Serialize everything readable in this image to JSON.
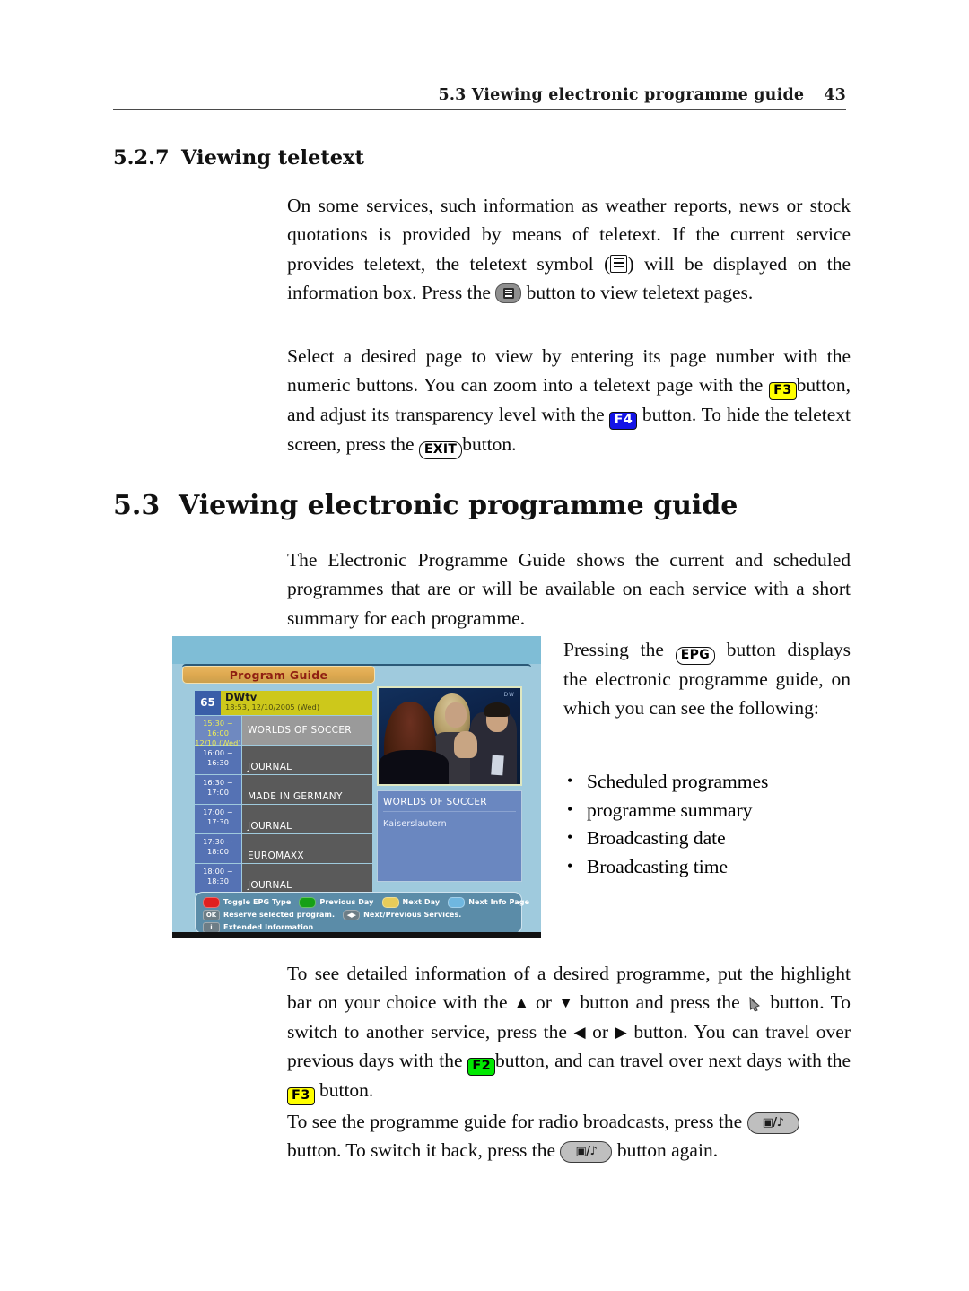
{
  "header": {
    "running_title": "5.3 Viewing electronic programme guide",
    "page_number": "43"
  },
  "sections": {
    "teletext": {
      "number": "5.2.7",
      "title": "Viewing teletext",
      "p1_a": "On some services, such information as weather reports, news or stock quotations is provided by means of teletext. If the current service provides teletext, the teletext symbol (",
      "p1_b": ") will be displayed on the information box. Press the",
      "p1_c": "button to view teletext pages.",
      "p2_a": "Select a desired page to view by entering its page number with the numeric buttons. You can zoom into a teletext page with the",
      "key_f3": "F3",
      "p2_b": "button, and adjust its transparency level with the",
      "key_f4": "F4",
      "p2_c": "button. To hide the teletext screen, press the",
      "key_exit": "EXIT",
      "p2_d": "button."
    },
    "epg": {
      "number": "5.3",
      "title": "Viewing electronic programme guide",
      "p1": "The Electronic Programme Guide shows the current and scheduled programmes that are or will be available on each service with a short summary for each programme.",
      "p2_a": "Pressing the",
      "key_epg": "EPG",
      "p2_b": "button displays the electronic programme guide, on which you can see the following:",
      "bullets": [
        "Scheduled programmes",
        "programme summary",
        "Broadcasting date",
        "Broadcasting time"
      ],
      "p3_a": "To see detailed information of a desired programme, put the highlight bar on your choice with the",
      "arrow_up": "▲",
      "p3_or1": "or",
      "arrow_down": "▼",
      "p3_b": "button and press the",
      "p3_c": "button. To switch to another service, press the",
      "arrow_left": "◀",
      "p3_or2": "or",
      "arrow_right": "▶",
      "p3_d": "button. You can travel over previous days with the",
      "key_f2": "F2",
      "p3_e": "button, and can travel over next days with the",
      "key_f3": "F3",
      "p3_f": "button.",
      "p4_a": "To see the programme guide for radio broadcasts, press the",
      "p4_b": "button. To switch it back, press the",
      "p4_c": "button again.",
      "tv_radio_glyph": "▣/♪"
    }
  },
  "epg_screenshot": {
    "title_bar": "Program Guide",
    "channel": {
      "number": "65",
      "name": "DWtv",
      "datetime": "18:53, 12/10/2005 (Wed)"
    },
    "programmes": [
      {
        "time": "15:30 ~ 16:00",
        "date": "12/10 (Wed)",
        "name": "WORLDS OF SOCCER",
        "selected": true
      },
      {
        "time": "16:00 ~ 16:30",
        "date": "",
        "name": "JOURNAL",
        "selected": false
      },
      {
        "time": "16:30 ~ 17:00",
        "date": "",
        "name": "MADE IN GERMANY",
        "selected": false
      },
      {
        "time": "17:00 ~ 17:30",
        "date": "",
        "name": "JOURNAL",
        "selected": false
      },
      {
        "time": "17:30 ~ 18:00",
        "date": "",
        "name": "EUROMAXX",
        "selected": false
      },
      {
        "time": "18:00 ~ 18:30",
        "date": "",
        "name": "JOURNAL",
        "selected": false
      }
    ],
    "info_panel": {
      "title": "WORLDS OF SOCCER",
      "summary": "Kaiserslautern"
    },
    "video_logo": "DW",
    "legend": {
      "row1": [
        {
          "swatch": "red",
          "label": "Toggle EPG Type"
        },
        {
          "swatch": "green",
          "label": "Previous Day"
        },
        {
          "swatch": "yellow",
          "label": "Next Day"
        },
        {
          "swatch": "blue",
          "label": "Next Info Page"
        }
      ],
      "row2": [
        {
          "key": "OK",
          "label": "Reserve selected program."
        },
        {
          "key": "◀▶",
          "label": "Next/Previous Services."
        }
      ],
      "row3": [
        {
          "key": "i",
          "label": "Extended Information"
        }
      ]
    }
  },
  "colors": {
    "key_yellow": "#ffff00",
    "key_blue": "#1414e6",
    "key_green": "#00e800",
    "epg_background": "#9fcadd",
    "epg_title_text": "#8f1f12",
    "channel_highlight": "#cdc81b"
  }
}
